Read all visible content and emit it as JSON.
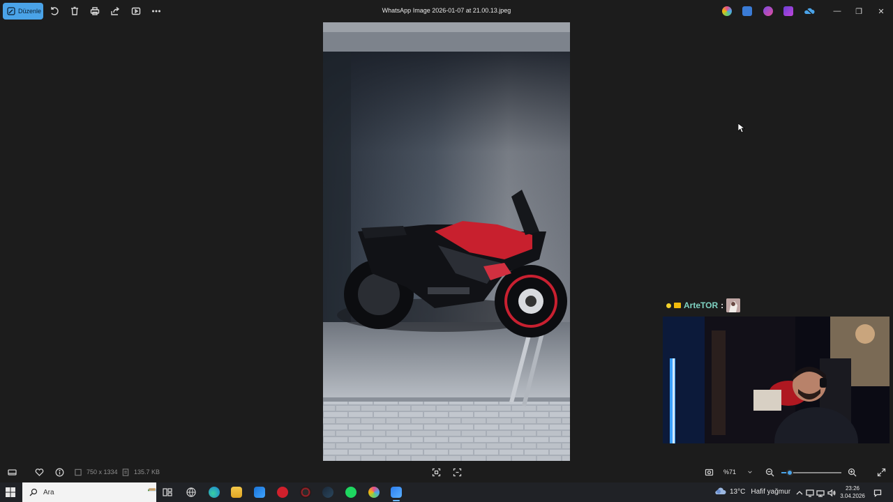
{
  "app": {
    "title": "WhatsApp Image 2026-01-07 at 21.00.13.jpeg",
    "edit_label": "Düzenle",
    "toolbar_icons": [
      "rotate-icon",
      "delete-icon",
      "print-icon",
      "share-icon",
      "slideshow-icon",
      "more-icon"
    ],
    "tray_apps": [
      "copilot-icon",
      "photos-editor-icon",
      "clipchamp-icon",
      "designer-icon",
      "onedrive-offline-icon"
    ],
    "window_controls": {
      "minimize": "—",
      "maximize": "❐",
      "close": "✕"
    }
  },
  "image": {
    "description_icon": "motorcycle-photo",
    "dimensions": "750 x 1334",
    "filesize": "135.7 KB"
  },
  "zoom": {
    "value": "%71",
    "slider_fraction": 0.14
  },
  "overlay": {
    "chat_user": "ArteTOR",
    "chat_separator": ":"
  },
  "taskbar": {
    "search_placeholder": "Ara",
    "weather_temp": "13°C",
    "weather_text": "Hafif yağmur",
    "time": "23:26",
    "date": "3.04.2026"
  },
  "colors": {
    "accent": "#4aa3e8",
    "background": "#1c1c1c",
    "taskbar": "#202226",
    "chat_user": "#7fd3c3"
  }
}
